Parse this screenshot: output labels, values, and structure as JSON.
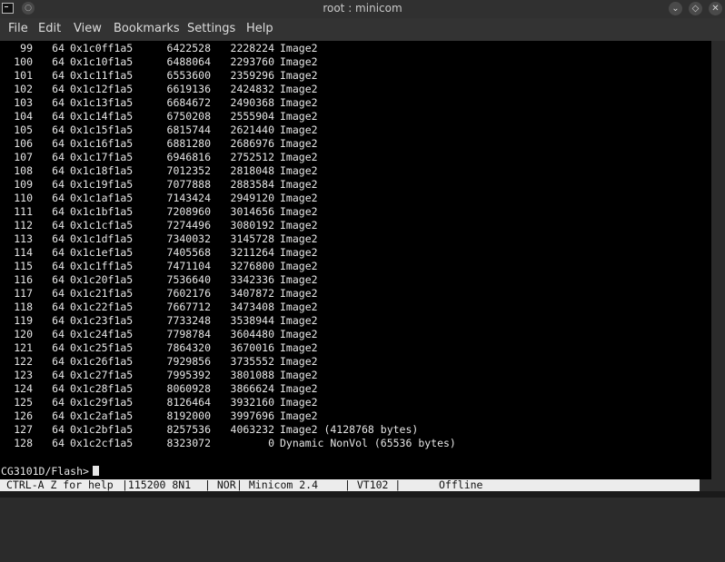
{
  "window": {
    "title": "root : minicom"
  },
  "menu": [
    "File",
    "Edit",
    "View",
    "Bookmarks",
    "Settings",
    "Help"
  ],
  "rows": [
    [
      "99",
      "64",
      "0x1c0ff1a5",
      "6422528",
      "2228224",
      "Image2"
    ],
    [
      "100",
      "64",
      "0x1c10f1a5",
      "6488064",
      "2293760",
      "Image2"
    ],
    [
      "101",
      "64",
      "0x1c11f1a5",
      "6553600",
      "2359296",
      "Image2"
    ],
    [
      "102",
      "64",
      "0x1c12f1a5",
      "6619136",
      "2424832",
      "Image2"
    ],
    [
      "103",
      "64",
      "0x1c13f1a5",
      "6684672",
      "2490368",
      "Image2"
    ],
    [
      "104",
      "64",
      "0x1c14f1a5",
      "6750208",
      "2555904",
      "Image2"
    ],
    [
      "105",
      "64",
      "0x1c15f1a5",
      "6815744",
      "2621440",
      "Image2"
    ],
    [
      "106",
      "64",
      "0x1c16f1a5",
      "6881280",
      "2686976",
      "Image2"
    ],
    [
      "107",
      "64",
      "0x1c17f1a5",
      "6946816",
      "2752512",
      "Image2"
    ],
    [
      "108",
      "64",
      "0x1c18f1a5",
      "7012352",
      "2818048",
      "Image2"
    ],
    [
      "109",
      "64",
      "0x1c19f1a5",
      "7077888",
      "2883584",
      "Image2"
    ],
    [
      "110",
      "64",
      "0x1c1af1a5",
      "7143424",
      "2949120",
      "Image2"
    ],
    [
      "111",
      "64",
      "0x1c1bf1a5",
      "7208960",
      "3014656",
      "Image2"
    ],
    [
      "112",
      "64",
      "0x1c1cf1a5",
      "7274496",
      "3080192",
      "Image2"
    ],
    [
      "113",
      "64",
      "0x1c1df1a5",
      "7340032",
      "3145728",
      "Image2"
    ],
    [
      "114",
      "64",
      "0x1c1ef1a5",
      "7405568",
      "3211264",
      "Image2"
    ],
    [
      "115",
      "64",
      "0x1c1ff1a5",
      "7471104",
      "3276800",
      "Image2"
    ],
    [
      "116",
      "64",
      "0x1c20f1a5",
      "7536640",
      "3342336",
      "Image2"
    ],
    [
      "117",
      "64",
      "0x1c21f1a5",
      "7602176",
      "3407872",
      "Image2"
    ],
    [
      "118",
      "64",
      "0x1c22f1a5",
      "7667712",
      "3473408",
      "Image2"
    ],
    [
      "119",
      "64",
      "0x1c23f1a5",
      "7733248",
      "3538944",
      "Image2"
    ],
    [
      "120",
      "64",
      "0x1c24f1a5",
      "7798784",
      "3604480",
      "Image2"
    ],
    [
      "121",
      "64",
      "0x1c25f1a5",
      "7864320",
      "3670016",
      "Image2"
    ],
    [
      "122",
      "64",
      "0x1c26f1a5",
      "7929856",
      "3735552",
      "Image2"
    ],
    [
      "123",
      "64",
      "0x1c27f1a5",
      "7995392",
      "3801088",
      "Image2"
    ],
    [
      "124",
      "64",
      "0x1c28f1a5",
      "8060928",
      "3866624",
      "Image2"
    ],
    [
      "125",
      "64",
      "0x1c29f1a5",
      "8126464",
      "3932160",
      "Image2"
    ],
    [
      "126",
      "64",
      "0x1c2af1a5",
      "8192000",
      "3997696",
      "Image2"
    ],
    [
      "127",
      "64",
      "0x1c2bf1a5",
      "8257536",
      "4063232",
      "Image2 (4128768 bytes)"
    ],
    [
      "128",
      "64",
      "0x1c2cf1a5",
      "8323072",
      "0",
      "Dynamic NonVol (65536 bytes)"
    ]
  ],
  "prompt": "CG3101D/Flash>",
  "status": {
    "help": "CTRL-A Z for help",
    "port": "|115200 8N1",
    "mode": "| NOR",
    "version": "| Minicom 2.4",
    "term": "| VT102 |",
    "online": "Offline"
  },
  "icons": {
    "app": "terminal-icon",
    "pin": "pin-icon",
    "minimize": "chevron-down-icon",
    "maximize": "diamond-icon",
    "close": "close-icon"
  },
  "colors": {
    "terminal_bg": "#000000",
    "terminal_fg": "#e6e6e6",
    "status_bg": "#ececec"
  }
}
